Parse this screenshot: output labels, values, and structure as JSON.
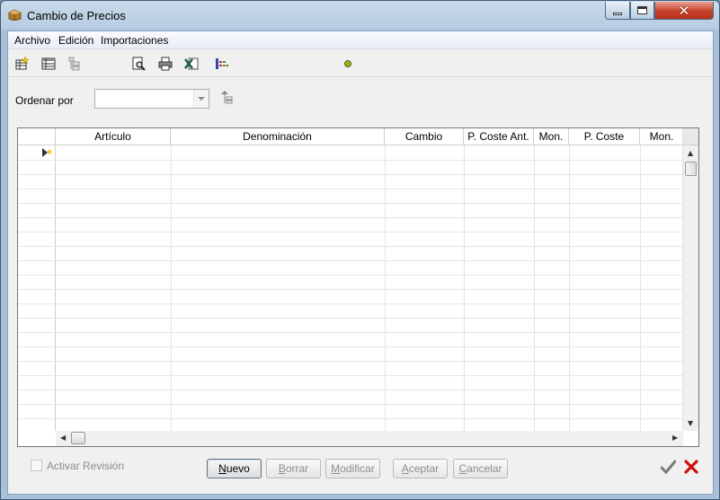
{
  "window": {
    "title": "Cambio de Precios"
  },
  "menu": {
    "items": [
      "Archivo",
      "Edición",
      "Importaciones"
    ]
  },
  "toolbar": {
    "icons": [
      "new-record-icon",
      "table-view-icon",
      "tree-view-icon",
      "print-preview-icon",
      "print-icon",
      "excel-export-icon",
      "columns-icon",
      "status-light-icon"
    ]
  },
  "filter": {
    "order_label": "Ordenar por",
    "order_value": ""
  },
  "grid": {
    "columns": [
      "Artículo",
      "Denominación",
      "Cambio",
      "P. Coste Ant.",
      "Mon.",
      "P. Coste",
      "Mon."
    ],
    "rows": []
  },
  "footer": {
    "checkbox_label": "Activar Revisión",
    "buttons": {
      "nuevo": {
        "pre": "",
        "key": "N",
        "post": "uevo"
      },
      "borrar": {
        "pre": "",
        "key": "B",
        "post": "orrar"
      },
      "modificar": {
        "pre": "",
        "key": "M",
        "post": "odificar"
      },
      "aceptar": {
        "pre": "",
        "key": "A",
        "post": "ceptar"
      },
      "cancelar": {
        "pre": "",
        "key": "C",
        "post": "ancelar"
      }
    }
  },
  "colors": {
    "title_bar": "#b7cde2",
    "close_button": "#c6402a",
    "ok_check": "#7a7a7a",
    "cancel_x": "#cc1111"
  }
}
